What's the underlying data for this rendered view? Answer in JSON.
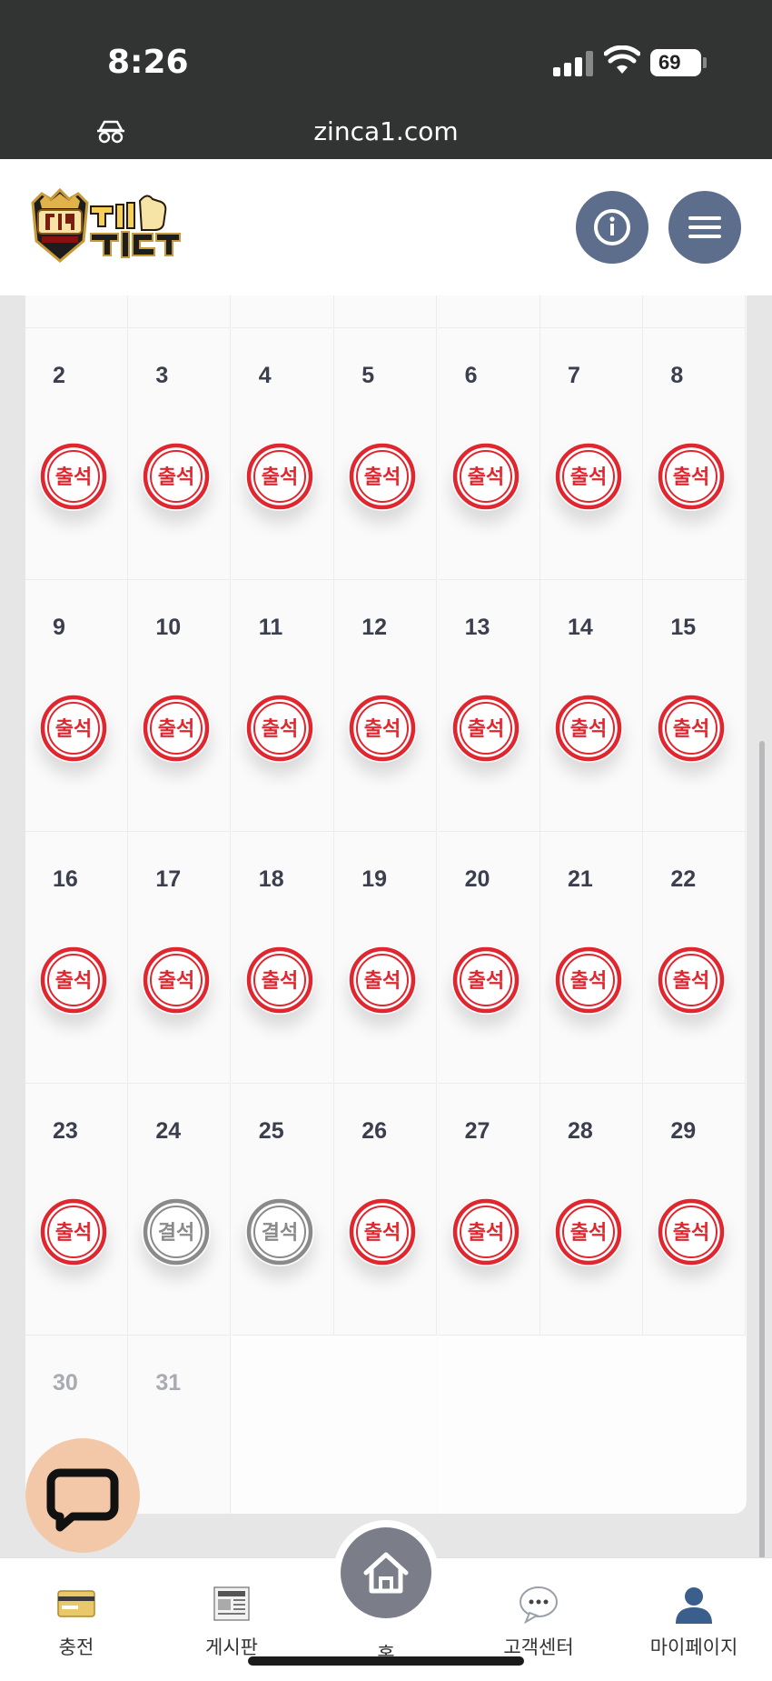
{
  "statusbar": {
    "time": "8:26",
    "battery": "69",
    "url": "zinca1.com"
  },
  "header": {
    "logo_alt": "찐 CASINO 찐카지노"
  },
  "calendar": {
    "present_label": "출석",
    "absent_label": "결석",
    "rows": [
      [
        {
          "day": "2",
          "status": "present"
        },
        {
          "day": "3",
          "status": "present"
        },
        {
          "day": "4",
          "status": "present"
        },
        {
          "day": "5",
          "status": "present"
        },
        {
          "day": "6",
          "status": "present"
        },
        {
          "day": "7",
          "status": "present"
        },
        {
          "day": "8",
          "status": "present"
        }
      ],
      [
        {
          "day": "9",
          "status": "present"
        },
        {
          "day": "10",
          "status": "present"
        },
        {
          "day": "11",
          "status": "present"
        },
        {
          "day": "12",
          "status": "present"
        },
        {
          "day": "13",
          "status": "present"
        },
        {
          "day": "14",
          "status": "present"
        },
        {
          "day": "15",
          "status": "present"
        }
      ],
      [
        {
          "day": "16",
          "status": "present"
        },
        {
          "day": "17",
          "status": "present"
        },
        {
          "day": "18",
          "status": "present"
        },
        {
          "day": "19",
          "status": "present"
        },
        {
          "day": "20",
          "status": "present"
        },
        {
          "day": "21",
          "status": "present"
        },
        {
          "day": "22",
          "status": "present"
        }
      ],
      [
        {
          "day": "23",
          "status": "present"
        },
        {
          "day": "24",
          "status": "absent"
        },
        {
          "day": "25",
          "status": "absent"
        },
        {
          "day": "26",
          "status": "present"
        },
        {
          "day": "27",
          "status": "present"
        },
        {
          "day": "28",
          "status": "present"
        },
        {
          "day": "29",
          "status": "present"
        }
      ],
      [
        {
          "day": "30",
          "status": "future"
        },
        {
          "day": "31",
          "status": "future"
        }
      ]
    ]
  },
  "bottom_nav": {
    "items": [
      {
        "label": "충전",
        "icon": "card-icon"
      },
      {
        "label": "게시판",
        "icon": "newspaper-icon"
      },
      {
        "label": "홈",
        "icon": "home-icon"
      },
      {
        "label": "고객센터",
        "icon": "speech-bubble-icon"
      },
      {
        "label": "마이페이지",
        "icon": "person-icon"
      }
    ]
  },
  "colors": {
    "present_stamp": "#e0262e",
    "absent_stamp": "#8a8a8a",
    "header_button": "#5d6e8c",
    "chat_button": "#f3c8a9"
  }
}
